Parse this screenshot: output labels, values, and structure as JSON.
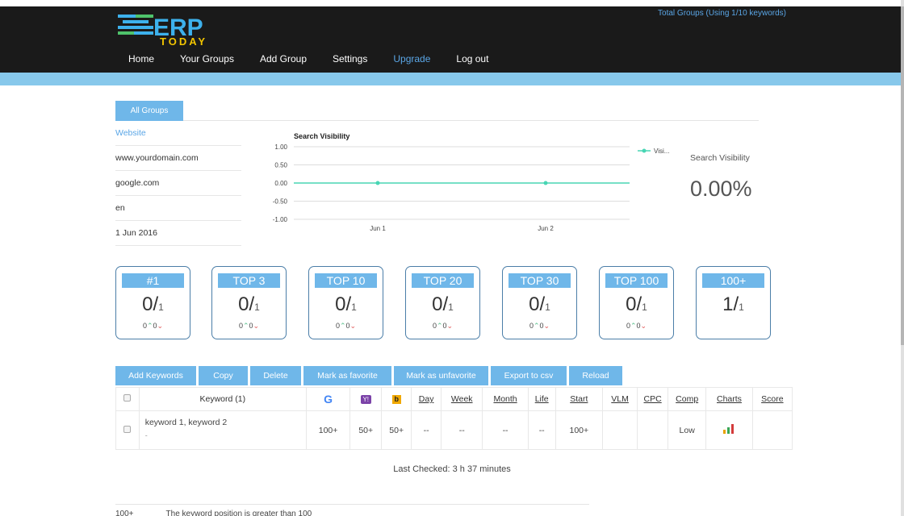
{
  "header": {
    "logo_main": "ERP",
    "logo_sub": "TODAY",
    "total_groups": "Total Groups (Using 1/10 keywords)",
    "nav": [
      {
        "label": "Home"
      },
      {
        "label": "Your Groups"
      },
      {
        "label": "Add Group"
      },
      {
        "label": "Settings"
      },
      {
        "label": "Upgrade"
      },
      {
        "label": "Log out"
      }
    ],
    "active_nav": "Upgrade"
  },
  "tabs": {
    "all_groups": "All Groups"
  },
  "website_info": {
    "heading": "Website",
    "domain": "www.yourdomain.com",
    "engine": "google.com",
    "language": "en",
    "date": "1 Jun 2016"
  },
  "visibility": {
    "label": "Search Visibility",
    "value": "0.00%"
  },
  "chart_data": {
    "type": "line",
    "title": "Search Visibility",
    "categories": [
      "Jun 1",
      "Jun 2"
    ],
    "series": [
      {
        "name": "Visi...",
        "values": [
          0,
          0
        ],
        "color": "#48d6b4"
      }
    ],
    "yticks": [
      "1.00",
      "0.50",
      "0.00",
      "-0.50",
      "-1.00"
    ],
    "ylim": [
      -1,
      1
    ],
    "legend": "top-right"
  },
  "ranks": [
    {
      "title": "#1",
      "value": "0",
      "total": "1",
      "up": "0",
      "down": "0"
    },
    {
      "title": "TOP 3",
      "value": "0",
      "total": "1",
      "up": "0",
      "down": "0"
    },
    {
      "title": "TOP 10",
      "value": "0",
      "total": "1",
      "up": "0",
      "down": "0"
    },
    {
      "title": "TOP 20",
      "value": "0",
      "total": "1",
      "up": "0",
      "down": "0"
    },
    {
      "title": "TOP 30",
      "value": "0",
      "total": "1",
      "up": "0",
      "down": "0"
    },
    {
      "title": "TOP 100",
      "value": "0",
      "total": "1",
      "up": "0",
      "down": "0"
    },
    {
      "title": "100+",
      "value": "1",
      "total": "1"
    }
  ],
  "actions": {
    "add_keywords": "Add Keywords",
    "copy": "Copy",
    "delete": "Delete",
    "mark_favorite": "Mark as favorite",
    "mark_unfavorite": "Mark as unfavorite",
    "export_csv": "Export to csv",
    "reload": "Reload"
  },
  "table": {
    "headers": {
      "keyword": "Keyword (1)",
      "google": "G",
      "yahoo": "Y!",
      "bing": "b",
      "day": "Day",
      "week": "Week",
      "month": "Month",
      "life": "Life",
      "start": "Start",
      "vlm": "VLM",
      "cpc": "CPC",
      "comp": "Comp",
      "charts": "Charts",
      "score": "Score"
    },
    "row": {
      "keyword": "keyword 1, keyword 2",
      "sub": "-",
      "google": "100+",
      "yahoo": "50+",
      "bing": "50+",
      "day": "--",
      "week": "--",
      "month": "--",
      "life": "--",
      "start": "100+",
      "vlm": "",
      "cpc": "",
      "comp": "Low",
      "score": ""
    }
  },
  "last_checked": "Last Checked: 3 h 37 minutes",
  "legend": {
    "key": "100+",
    "desc": "The keyword position is greater than 100"
  }
}
